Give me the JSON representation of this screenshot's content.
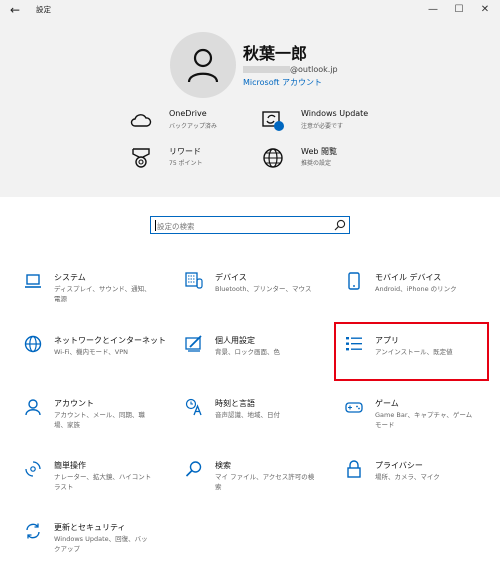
{
  "window": {
    "title": "設定",
    "back_glyph": "←",
    "minimize_glyph": "—",
    "maximize_glyph": "☐",
    "close_glyph": "✕"
  },
  "header": {
    "user_name": "秋葉一郎",
    "email_suffix": "@outlook.jp",
    "account_link": "Microsoft アカウント",
    "quick_links": [
      {
        "title": "OneDrive",
        "subtitle": "バックアップ済み",
        "icon": "cloud-icon"
      },
      {
        "title": "Windows Update",
        "subtitle": "注意が必要です",
        "icon": "windows-update-icon"
      },
      {
        "title": "リワード",
        "subtitle": "75 ポイント",
        "icon": "medal-icon"
      },
      {
        "title": "Web 閲覧",
        "subtitle": "推奨の設定",
        "icon": "globe-icon"
      }
    ]
  },
  "search": {
    "placeholder": "設定の検索"
  },
  "categories": [
    {
      "title": "システム",
      "subtitle": "ディスプレイ、サウンド、通知、電源",
      "icon": "laptop-icon"
    },
    {
      "title": "デバイス",
      "subtitle": "Bluetooth、プリンター、マウス",
      "icon": "keyboard-icon"
    },
    {
      "title": "モバイル デバイス",
      "subtitle": "Android、iPhone のリンク",
      "icon": "phone-icon"
    },
    {
      "title": "ネットワークとインターネット",
      "subtitle": "Wi-Fi、機内モード、VPN",
      "icon": "globe-icon"
    },
    {
      "title": "個人用設定",
      "subtitle": "背景、ロック画面、色",
      "icon": "paint-icon"
    },
    {
      "title": "アプリ",
      "subtitle": "アンインストール、既定値",
      "icon": "apps-list-icon"
    },
    {
      "title": "アカウント",
      "subtitle": "アカウント、メール、同期、職場、家族",
      "icon": "person-icon"
    },
    {
      "title": "時刻と言語",
      "subtitle": "音声認識、地域、日付",
      "icon": "time-language-icon"
    },
    {
      "title": "ゲーム",
      "subtitle": "Game Bar、キャプチャ、ゲーム モード",
      "icon": "gamepad-icon"
    },
    {
      "title": "簡単操作",
      "subtitle": "ナレーター、拡大鏡、ハイコントラスト",
      "icon": "ease-of-access-icon"
    },
    {
      "title": "検索",
      "subtitle": "マイ ファイル、アクセス許可の検索",
      "icon": "search-icon"
    },
    {
      "title": "プライバシー",
      "subtitle": "場所、カメラ、マイク",
      "icon": "lock-icon"
    },
    {
      "title": "更新とセキュリティ",
      "subtitle": "Windows Update、回復、バックアップ",
      "icon": "update-icon"
    }
  ],
  "colors": {
    "accent": "#0067c0",
    "header_bg": "#f2f2f2",
    "highlight_border": "#e60012"
  }
}
